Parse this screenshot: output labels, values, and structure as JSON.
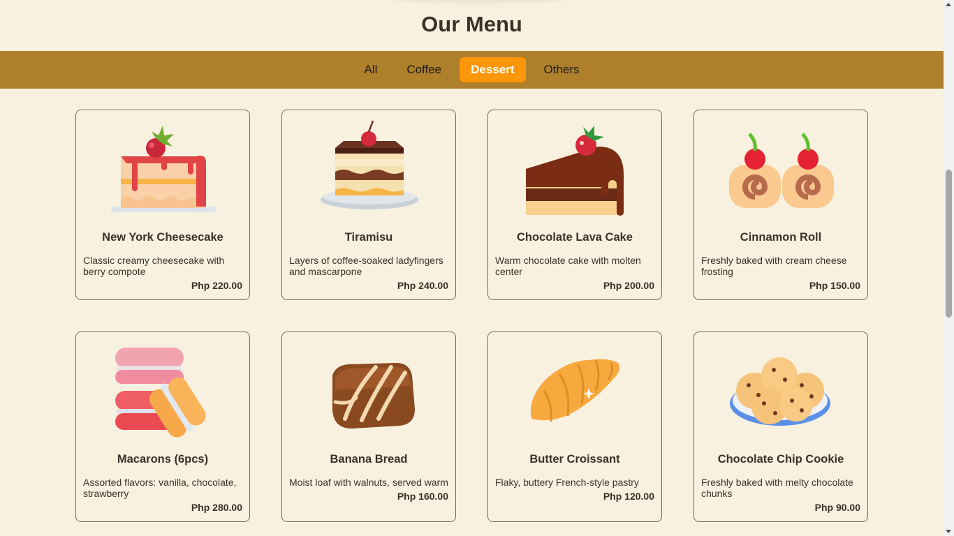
{
  "header": {
    "title": "Our Menu"
  },
  "tabs": [
    {
      "label": "All",
      "active": false
    },
    {
      "label": "Coffee",
      "active": false
    },
    {
      "label": "Dessert",
      "active": true
    },
    {
      "label": "Others",
      "active": false
    }
  ],
  "items": [
    {
      "name": "New York Cheesecake",
      "description": "Classic creamy cheesecake with berry compote",
      "price": "Php 220.00",
      "icon": "cheesecake-icon"
    },
    {
      "name": "Tiramisu",
      "description": "Layers of coffee-soaked ladyfingers and mascarpone",
      "price": "Php 240.00",
      "icon": "tiramisu-icon"
    },
    {
      "name": "Chocolate Lava Cake",
      "description": "Warm chocolate cake with molten center",
      "price": "Php 200.00",
      "icon": "chocolate-cake-icon"
    },
    {
      "name": "Cinnamon Roll",
      "description": "Freshly baked with cream cheese frosting",
      "price": "Php 150.00",
      "icon": "cinnamon-roll-icon"
    },
    {
      "name": "Macarons (6pcs)",
      "description": "Assorted flavors: vanilla, chocolate, strawberry",
      "price": "Php 280.00",
      "icon": "macarons-icon"
    },
    {
      "name": "Banana Bread",
      "description": "Moist loaf with walnuts, served warm",
      "price": "Php 160.00",
      "icon": "banana-bread-icon"
    },
    {
      "name": "Butter Croissant",
      "description": "Flaky, buttery French-style pastry",
      "price": "Php 120.00",
      "icon": "croissant-icon"
    },
    {
      "name": "Chocolate Chip Cookie",
      "description": "Freshly baked with melty chocolate chunks",
      "price": "Php 90.00",
      "icon": "cookies-icon"
    }
  ],
  "colors": {
    "background": "#f8f1e0",
    "tabbar": "#ae802c",
    "active_tab": "#fd9608",
    "text": "#3d3029"
  }
}
